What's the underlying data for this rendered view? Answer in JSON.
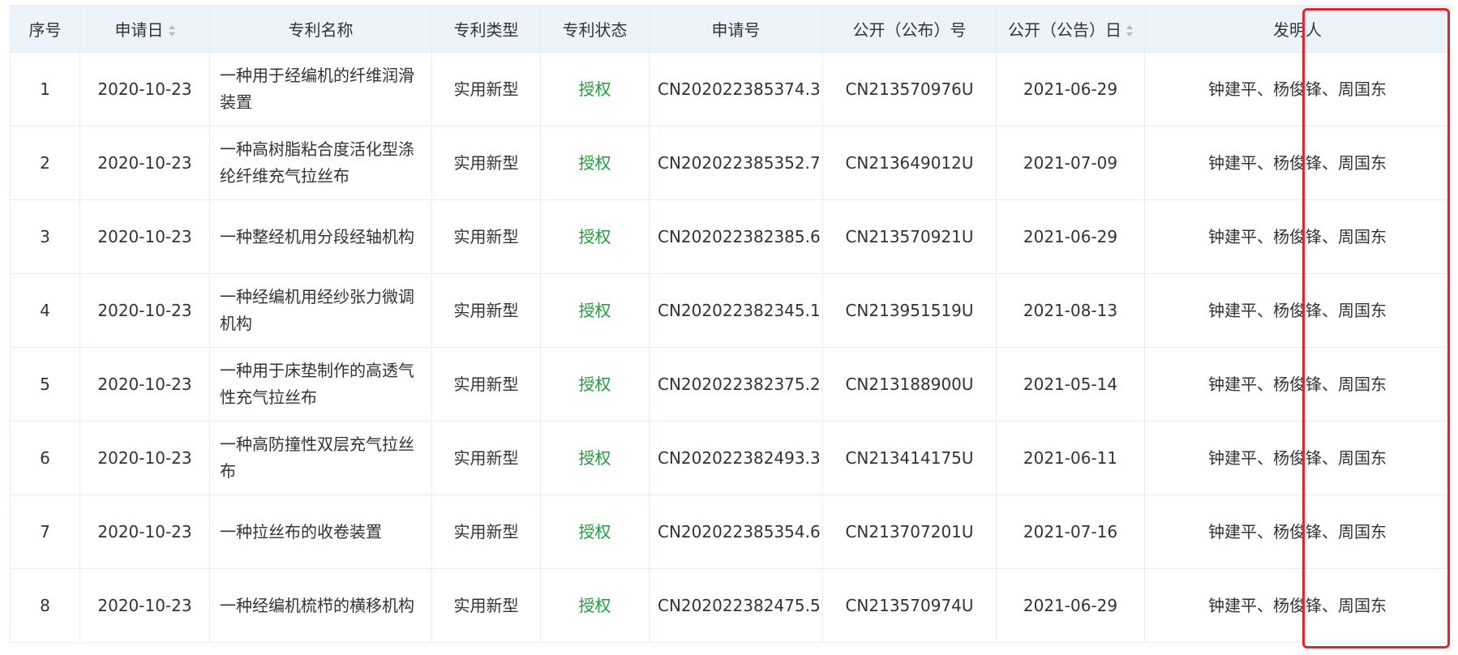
{
  "table": {
    "headers": {
      "index": "序号",
      "apply_date": "申请日",
      "name": "专利名称",
      "type": "专利类型",
      "status": "专利状态",
      "apply_no": "申请号",
      "pub_no": "公开（公布）号",
      "pub_date": "公开（公告）日",
      "inventor": "发明人"
    },
    "rows": [
      {
        "index": "1",
        "apply_date": "2020-10-23",
        "name": "一种用于经编机的纤维润滑装置",
        "type": "实用新型",
        "status": "授权",
        "apply_no": "CN202022385374.3",
        "pub_no": "CN213570976U",
        "pub_date": "2021-06-29",
        "inventor": "钟建平、杨俊锋、周国东"
      },
      {
        "index": "2",
        "apply_date": "2020-10-23",
        "name": "一种高树脂粘合度活化型涤纶纤维充气拉丝布",
        "type": "实用新型",
        "status": "授权",
        "apply_no": "CN202022385352.7",
        "pub_no": "CN213649012U",
        "pub_date": "2021-07-09",
        "inventor": "钟建平、杨俊锋、周国东"
      },
      {
        "index": "3",
        "apply_date": "2020-10-23",
        "name": "一种整经机用分段经轴机构",
        "type": "实用新型",
        "status": "授权",
        "apply_no": "CN202022382385.6",
        "pub_no": "CN213570921U",
        "pub_date": "2021-06-29",
        "inventor": "钟建平、杨俊锋、周国东"
      },
      {
        "index": "4",
        "apply_date": "2020-10-23",
        "name": "一种经编机用经纱张力微调机构",
        "type": "实用新型",
        "status": "授权",
        "apply_no": "CN202022382345.1",
        "pub_no": "CN213951519U",
        "pub_date": "2021-08-13",
        "inventor": "钟建平、杨俊锋、周国东"
      },
      {
        "index": "5",
        "apply_date": "2020-10-23",
        "name": "一种用于床垫制作的高透气性充气拉丝布",
        "type": "实用新型",
        "status": "授权",
        "apply_no": "CN202022382375.2",
        "pub_no": "CN213188900U",
        "pub_date": "2021-05-14",
        "inventor": "钟建平、杨俊锋、周国东"
      },
      {
        "index": "6",
        "apply_date": "2020-10-23",
        "name": "一种高防撞性双层充气拉丝布",
        "type": "实用新型",
        "status": "授权",
        "apply_no": "CN202022382493.3",
        "pub_no": "CN213414175U",
        "pub_date": "2021-06-11",
        "inventor": "钟建平、杨俊锋、周国东"
      },
      {
        "index": "7",
        "apply_date": "2020-10-23",
        "name": "一种拉丝布的收卷装置",
        "type": "实用新型",
        "status": "授权",
        "apply_no": "CN202022385354.6",
        "pub_no": "CN213707201U",
        "pub_date": "2021-07-16",
        "inventor": "钟建平、杨俊锋、周国东"
      },
      {
        "index": "8",
        "apply_date": "2020-10-23",
        "name": "一种经编机梳栉的横移机构",
        "type": "实用新型",
        "status": "授权",
        "apply_no": "CN202022382475.5",
        "pub_no": "CN213570974U",
        "pub_date": "2021-06-29",
        "inventor": "钟建平、杨俊锋、周国东"
      }
    ]
  },
  "colors": {
    "header_bg": "#edf3fa",
    "border": "#e8edf3",
    "status_green": "#1f9b3a",
    "highlight_red": "#e0262b"
  },
  "icons": {
    "sort": "sort-caret-icon"
  }
}
